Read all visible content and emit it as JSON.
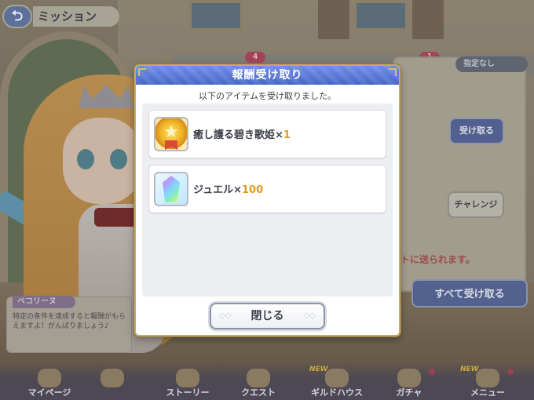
{
  "header": {
    "back_icon": "⮌",
    "title": "ミッション"
  },
  "background": {
    "badges": [
      "4",
      "1"
    ],
    "filter_pill": "指定なし",
    "claim_button": "受け取る",
    "challenge_button": "チャレンジ",
    "note": "トに送られます。",
    "claim_all_button": "すべて受け取る",
    "speech": {
      "name": "ペコリーヌ",
      "text": "特定の条件を達成すると報酬がもらえますよ！がんばりましょう♪"
    }
  },
  "bottom_nav": [
    {
      "label": "マイページ",
      "icon": "home-icon",
      "new": false,
      "dot": false
    },
    {
      "label": "",
      "icon": "character-icon",
      "new": false,
      "dot": false
    },
    {
      "label": "ストーリー",
      "icon": "book-icon",
      "new": false,
      "dot": false
    },
    {
      "label": "クエスト",
      "icon": "sword-icon",
      "new": false,
      "dot": false
    },
    {
      "label": "ギルドハウス",
      "icon": "house-icon",
      "new": true,
      "dot": false
    },
    {
      "label": "ガチャ",
      "icon": "gacha-icon",
      "new": false,
      "dot": true
    },
    {
      "label": "メニュー",
      "icon": "menu-icon",
      "new": true,
      "dot": true
    }
  ],
  "modal": {
    "title": "報酬受け取り",
    "subtitle": "以下のアイテムを受け取りました。",
    "items": [
      {
        "name": "癒し護る碧き歌姫",
        "times": "×",
        "qty": "1",
        "icon": "medal-icon"
      },
      {
        "name": "ジュエル",
        "times": "×",
        "qty": "100",
        "icon": "jewel-icon"
      }
    ],
    "close_label": "閉じる"
  },
  "colors": {
    "modal_header": "#4966c8",
    "modal_border": "#c7a869",
    "quantity": "#e39a1b",
    "text": "#3d3f4a"
  }
}
